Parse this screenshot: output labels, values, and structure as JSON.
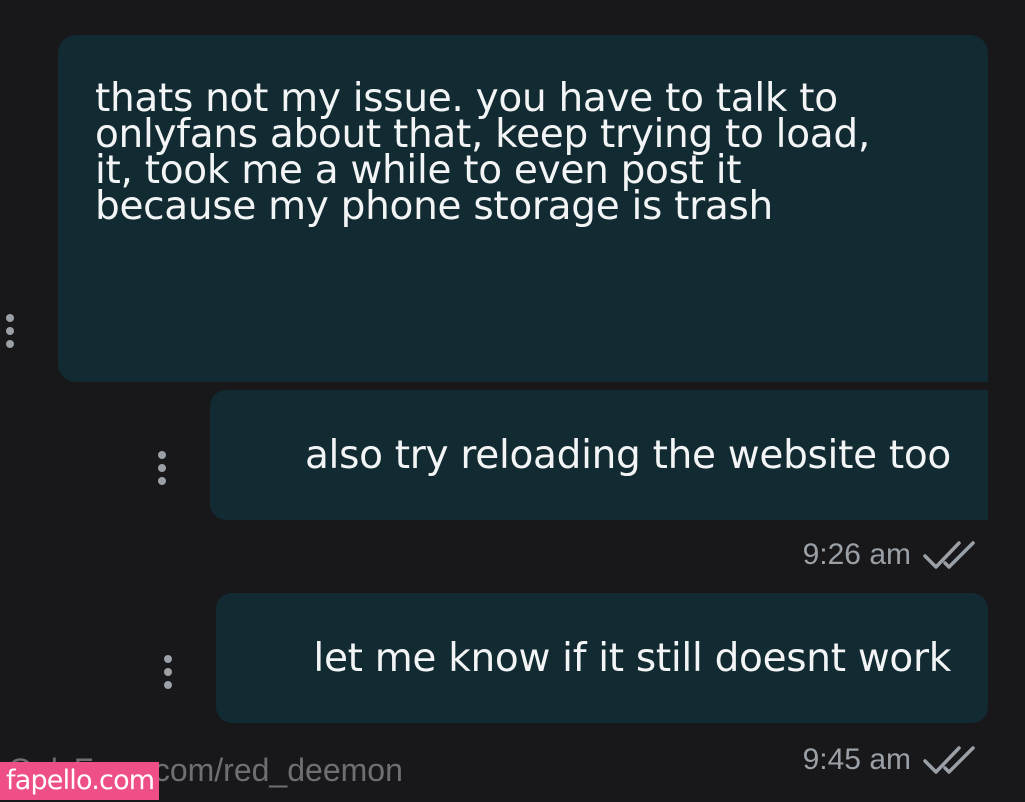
{
  "messages": [
    {
      "lines": [
        "thats not my issue. you have to talk to",
        "onlyfans about that, keep trying to load,",
        "it, took me a while to even post it",
        "because my phone storage is trash"
      ]
    },
    {
      "text": "also try reloading the website too",
      "time": "9:26 am"
    },
    {
      "text": "let me know if it still doesnt work",
      "time": "9:45 am"
    }
  ],
  "watermark": {
    "profile_url": "OnlyFans.com/red_deemon",
    "site_badge": "fapello.com"
  },
  "colors": {
    "background": "#18181b",
    "bubble": "#122a31",
    "meta": "#9aa0a6",
    "badge": "#ee4f87"
  },
  "icons": {
    "message_menu": "more-vertical-icon",
    "read_receipt": "double-check-icon"
  }
}
